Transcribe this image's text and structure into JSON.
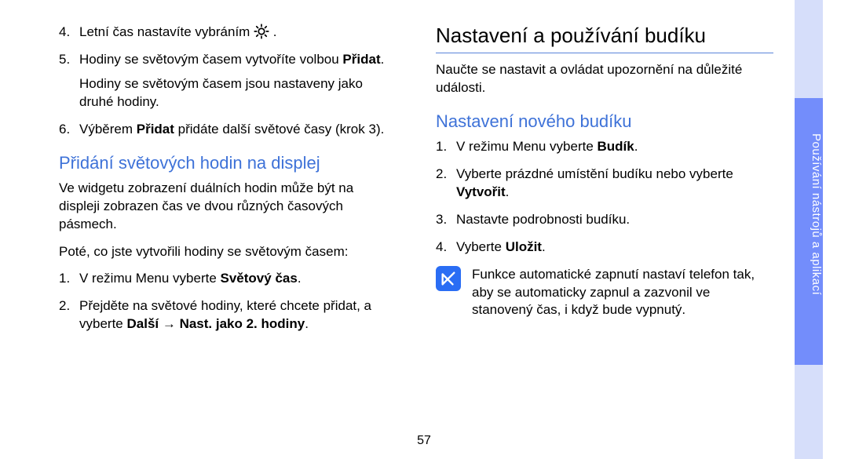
{
  "left": {
    "steps_a": [
      {
        "n": "4",
        "text_before": "Letní čas nastavíte vybráním ",
        "icon": "sun-icon",
        "text_after": " ."
      },
      {
        "n": "5",
        "text_before": "Hodiny se světovým časem vytvoříte volbou ",
        "bold": "Přidat",
        "text_after": "."
      }
    ],
    "indent": "Hodiny se světovým časem jsou nastaveny jako druhé hodiny.",
    "steps_a2": [
      {
        "n": "6",
        "text_before": "Výběrem ",
        "bold": "Přidat",
        "text_after": " přidáte další světové časy (krok 3)."
      }
    ],
    "h2": "Přidání světových hodin na displej",
    "p1": "Ve widgetu zobrazení duálních hodin může být na displeji zobrazen čas ve dvou různých časových pásmech.",
    "p2": "Poté, co jste vytvořili hodiny se světovým časem:",
    "steps_b": [
      {
        "n": "1",
        "text_before": "V režimu Menu vyberte ",
        "bold": "Světový čas",
        "text_after": "."
      },
      {
        "n": "2",
        "text_before": "Přejděte na světové hodiny, které chcete přidat, a vyberte ",
        "bold": "Další → Nast. jako 2. hodiny",
        "text_after": "."
      }
    ]
  },
  "right": {
    "h1": "Nastavení a používání budíku",
    "p1": "Naučte se nastavit a ovládat upozornění na důležité události.",
    "h2": "Nastavení nového budíku",
    "steps": [
      {
        "n": "1",
        "text_before": "V režimu Menu vyberte ",
        "bold": "Budík",
        "text_after": "."
      },
      {
        "n": "2",
        "text_before": "Vyberte prázdné umístění budíku nebo vyberte ",
        "bold": "Vytvořit",
        "text_after": "."
      },
      {
        "n": "3",
        "text_before": "Nastavte podrobnosti budíku.",
        "bold": "",
        "text_after": ""
      },
      {
        "n": "4",
        "text_before": "Vyberte ",
        "bold": "Uložit",
        "text_after": "."
      }
    ],
    "note": "Funkce automatické zapnutí nastaví telefon tak, aby se automaticky zapnul a zazvonil ve stanovený čas, i když bude vypnutý."
  },
  "tab_label": "Používání nástrojů a aplikací",
  "page_number": "57"
}
